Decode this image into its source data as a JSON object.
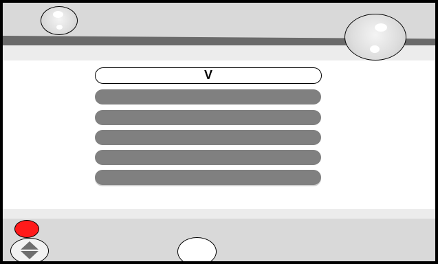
{
  "menu": {
    "selected_label": "V",
    "items": [
      {
        "label": ""
      },
      {
        "label": ""
      },
      {
        "label": ""
      },
      {
        "label": ""
      },
      {
        "label": ""
      }
    ]
  },
  "colors": {
    "record_button": "#ff1a1a",
    "menu_item": "#808080",
    "selected_item": "#ffffff",
    "frame": "#000000"
  },
  "icons": {
    "top_left": "bubble-button-icon",
    "top_right": "bubble-button-icon",
    "record": "record-icon",
    "scroll": "up-down-arrows-icon",
    "ok": "ok-button-icon"
  }
}
